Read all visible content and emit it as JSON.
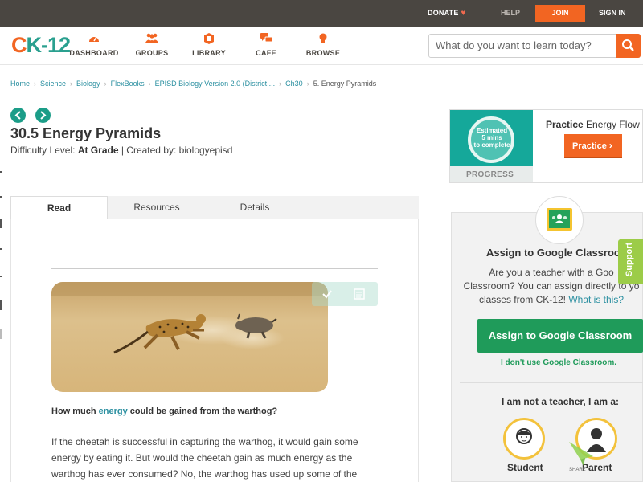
{
  "topbar": {
    "donate": "DONATE",
    "help": "HELP",
    "join": "JOIN",
    "signin": "SIGN IN"
  },
  "nav": {
    "logo_c": "C",
    "logo_k": "K",
    "logo_rest": "-12",
    "items": [
      {
        "label": "DASHBOARD",
        "icon": "gauge-icon"
      },
      {
        "label": "GROUPS",
        "icon": "group-icon"
      },
      {
        "label": "LIBRARY",
        "icon": "library-icon"
      },
      {
        "label": "CAFE",
        "icon": "chat-icon"
      },
      {
        "label": "BROWSE",
        "icon": "bulb-icon"
      }
    ],
    "search_placeholder": "What do you want to learn today?"
  },
  "breadcrumb": [
    "Home",
    "Science",
    "Biology",
    "FlexBooks",
    "EPISD Biology Version 2.0 (District ...",
    "Ch30",
    "5. Energy Pyramids"
  ],
  "article": {
    "title": "30.5 Energy Pyramids",
    "difficulty_prefix": "Difficulty Level: ",
    "difficulty": "At Grade",
    "created_by": " | Created by: biologyepisd",
    "tabs": [
      "Read",
      "Resources",
      "Details"
    ],
    "question_pre": "How much ",
    "question_kw": "energy",
    "question_post": " could be gained from the warthog?",
    "paragraph": "If the cheetah is successful in capturing the warthog, it would gain some energy by eating it. But would the cheetah gain as much energy as the warthog has ever consumed? No, the warthog has used up some of the"
  },
  "practice": {
    "estimated": "Estimated",
    "mins": "5 mins",
    "to_complete": "to complete",
    "progress": "PROGRESS",
    "title_bold": "Practice",
    "title_rest": " Energy Flow",
    "button": "Practice"
  },
  "assign": {
    "title": "Assign to Google Classroo",
    "line1": "Are you a teacher with a Goo",
    "line2": "Classroom? You can assign directly to yo",
    "line3_pre": "classes from CK-12! ",
    "line3_link": "What is this?",
    "button": "Assign to Google Classroom",
    "no_use": "I don't use Google Classroom.",
    "not_teacher": "I am not a teacher, I am a:",
    "roles": [
      "Student",
      "Parent"
    ],
    "support": "Support",
    "share": "SHARE"
  },
  "colors": {
    "orange": "#f26522",
    "teal": "#1b9d88",
    "green": "#1f9b5a",
    "gold": "#f3c23c",
    "topbar": "#4a4641"
  }
}
